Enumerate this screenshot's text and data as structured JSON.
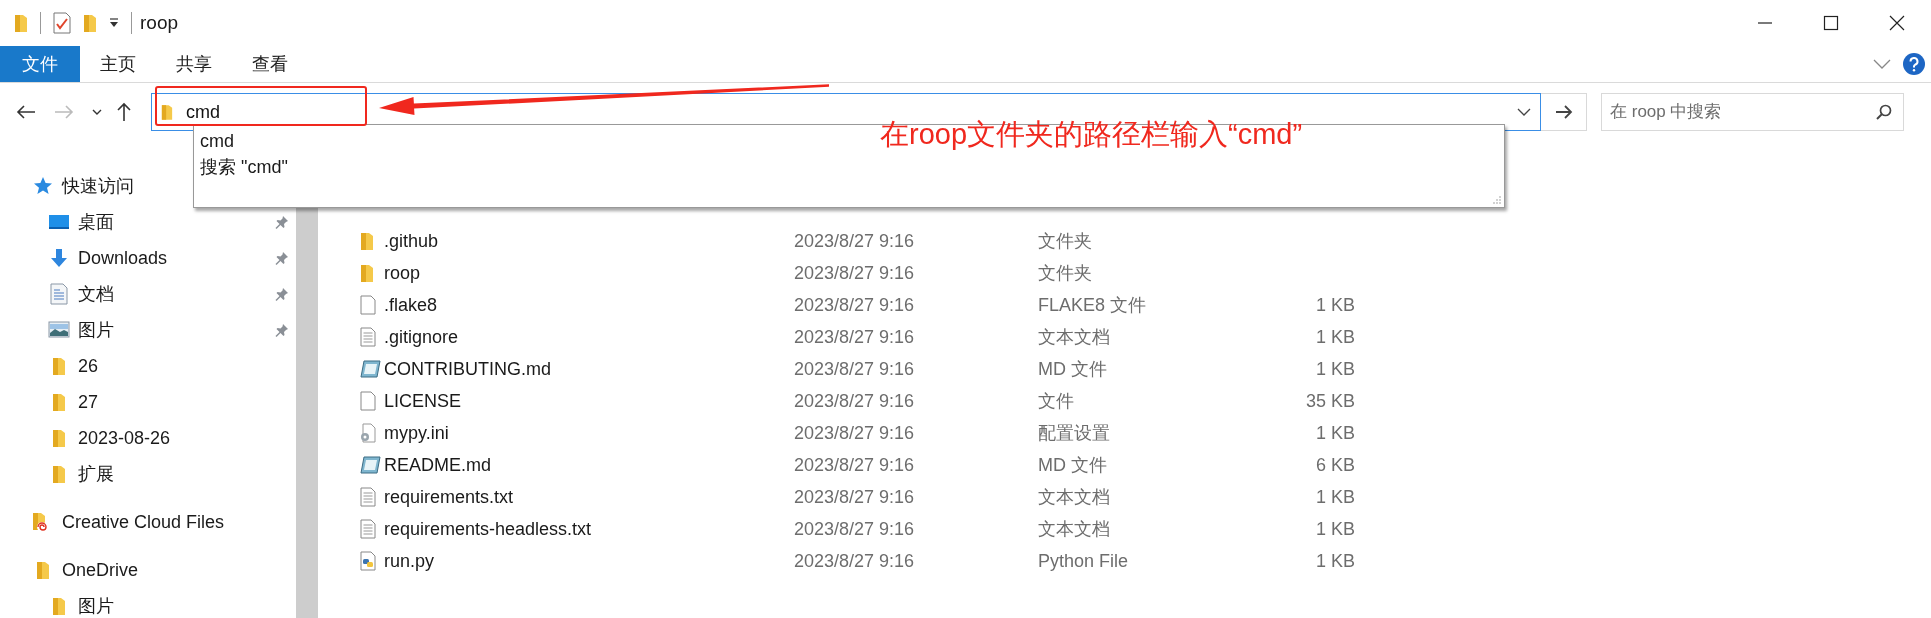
{
  "window": {
    "title": "roop"
  },
  "ribbon": {
    "tabs": [
      {
        "label": "文件",
        "kind": "file_menu"
      },
      {
        "label": "主页",
        "kind": "tab"
      },
      {
        "label": "共享",
        "kind": "tab"
      },
      {
        "label": "查看",
        "kind": "tab"
      }
    ]
  },
  "address_bar": {
    "value": "cmd"
  },
  "autocomplete": [
    "cmd",
    "搜索 \"cmd\""
  ],
  "search": {
    "placeholder": "在 roop 中搜索"
  },
  "sidebar": {
    "items": [
      {
        "label": "快速访问",
        "kind": "star",
        "children": [
          {
            "label": "桌面",
            "kind": "desktop",
            "pinned": true
          },
          {
            "label": "Downloads",
            "kind": "download",
            "pinned": true
          },
          {
            "label": "文档",
            "kind": "document",
            "pinned": true
          },
          {
            "label": "图片",
            "kind": "pictures",
            "pinned": true
          },
          {
            "label": "26",
            "kind": "folder",
            "pinned": false
          },
          {
            "label": "27",
            "kind": "folder",
            "pinned": false
          },
          {
            "label": "2023-08-26",
            "kind": "folder",
            "pinned": false
          },
          {
            "label": "扩展",
            "kind": "folder",
            "pinned": false
          }
        ]
      },
      {
        "label": "Creative Cloud Files",
        "kind": "cloud_folder"
      },
      {
        "label": "OneDrive",
        "kind": "folder",
        "children": [
          {
            "label": "图片",
            "kind": "folder",
            "pinned": false
          }
        ]
      }
    ]
  },
  "files": [
    {
      "name": ".github",
      "modified": "2023/8/27 9:16",
      "type": "文件夹",
      "kind": "folder"
    },
    {
      "name": "roop",
      "modified": "2023/8/27 9:16",
      "type": "文件夹",
      "kind": "folder"
    },
    {
      "name": ".flake8",
      "modified": "2023/8/27 9:16",
      "type": "FLAKE8 文件",
      "size": "1 KB",
      "kind": "blank"
    },
    {
      "name": ".gitignore",
      "modified": "2023/8/27 9:16",
      "type": "文本文档",
      "size": "1 KB",
      "kind": "text"
    },
    {
      "name": "CONTRIBUTING.md",
      "modified": "2023/8/27 9:16",
      "type": "MD 文件",
      "size": "1 KB",
      "kind": "markdown"
    },
    {
      "name": "LICENSE",
      "modified": "2023/8/27 9:16",
      "type": "文件",
      "size": "35 KB",
      "kind": "blank"
    },
    {
      "name": "mypy.ini",
      "modified": "2023/8/27 9:16",
      "type": "配置设置",
      "size": "1 KB",
      "kind": "config"
    },
    {
      "name": "README.md",
      "modified": "2023/8/27 9:16",
      "type": "MD 文件",
      "size": "6 KB",
      "kind": "markdown"
    },
    {
      "name": "requirements.txt",
      "modified": "2023/8/27 9:16",
      "type": "文本文档",
      "size": "1 KB",
      "kind": "text"
    },
    {
      "name": "requirements-headless.txt",
      "modified": "2023/8/27 9:16",
      "type": "文本文档",
      "size": "1 KB",
      "kind": "text"
    },
    {
      "name": "run.py",
      "modified": "2023/8/27 9:16",
      "type": "Python File",
      "size": "1 KB",
      "kind": "python"
    }
  ],
  "annotation": {
    "text": "在roop文件夹的路径栏输入“cmd”"
  }
}
